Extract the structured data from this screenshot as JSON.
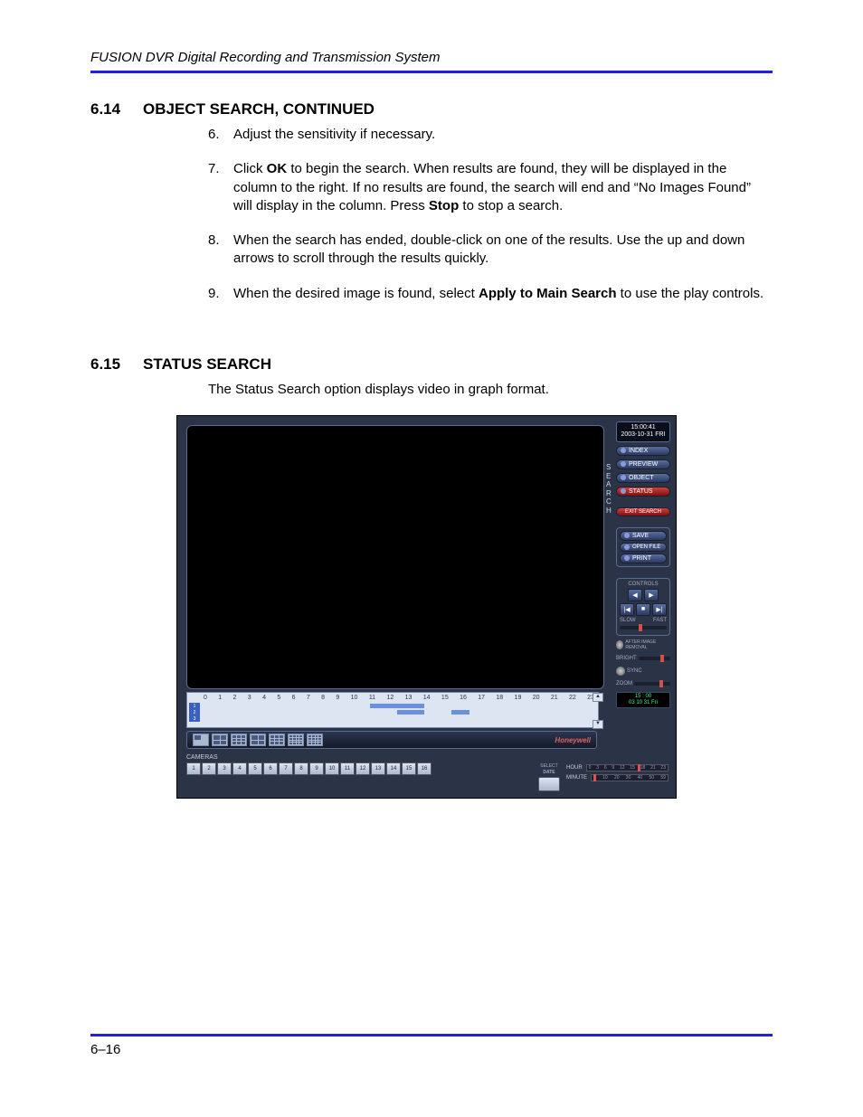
{
  "header": "FUSION DVR Digital Recording and Transmission System",
  "section614": {
    "num": "6.14",
    "title": "OBJECT SEARCH, CONTINUED"
  },
  "steps614": {
    "s6": {
      "n": "6.",
      "t": "Adjust the sensitivity if necessary."
    },
    "s7": {
      "n": "7.",
      "a": "Click ",
      "b1": "OK",
      "c": " to begin the search. When results are found, they will be displayed in the column to the right. If no results are found, the search will end and “No Images Found” will display in the column. Press ",
      "b2": "Stop",
      "d": " to stop a search."
    },
    "s8": {
      "n": "8.",
      "t": "When the search has ended, double-click on one of the results. Use the up and down arrows to scroll through the results quickly."
    },
    "s9": {
      "n": "9.",
      "a": "When the desired image is found, select ",
      "b1": "Apply to Main Search",
      "c": " to use the play controls."
    }
  },
  "section615": {
    "num": "6.15",
    "title": "STATUS SEARCH",
    "intro": "The Status Search option displays video in graph format."
  },
  "shot": {
    "clock_time": "15:00:41",
    "clock_date": "2003-10-31 FRI",
    "search_vert": "SEARCH",
    "btn_index": "INDEX",
    "btn_preview": "PREVIEW",
    "btn_object": "OBJECT",
    "btn_status": "STATUS",
    "btn_exit": "EXIT SEARCH",
    "btn_save": "SAVE",
    "btn_open": "OPEN FILE",
    "btn_print": "PRINT",
    "controls_label": "CONTROLS",
    "glyph_prev": "◀",
    "glyph_next": "▶",
    "glyph_first": "|◀",
    "glyph_stop": "■",
    "glyph_last": "▶|",
    "slow": "SLOW",
    "fast": "FAST",
    "after_image": "AFTER IMAGE REMOVAL",
    "sync": "SYNC",
    "bright": "BRIGHT",
    "zoom": "ZOOM",
    "mini_time": "15 : 00",
    "mini_date": "03 10 31 Fri",
    "hours": [
      "0",
      "1",
      "2",
      "3",
      "4",
      "5",
      "6",
      "7",
      "8",
      "9",
      "10",
      "11",
      "12",
      "13",
      "14",
      "15",
      "16",
      "17",
      "18",
      "19",
      "20",
      "21",
      "22",
      "23"
    ],
    "brand": "Honeywell",
    "cameras_label": "CAMERAS",
    "cameras": [
      "1",
      "2",
      "3",
      "4",
      "5",
      "6",
      "7",
      "8",
      "9",
      "10",
      "11",
      "12",
      "13",
      "14",
      "15",
      "16"
    ],
    "seldate": "SELECT",
    "seldate2": "DATE",
    "hour_label": "HOUR",
    "minute_label": "MINUTE",
    "hour_ticks": [
      "0",
      "3",
      "6",
      "9",
      "12",
      "15",
      "18",
      "21",
      "23"
    ],
    "min_ticks": [
      "0",
      "10",
      "20",
      "30",
      "40",
      "50",
      "59"
    ],
    "up": "▲",
    "dn": "▼"
  },
  "footer": "6–16"
}
